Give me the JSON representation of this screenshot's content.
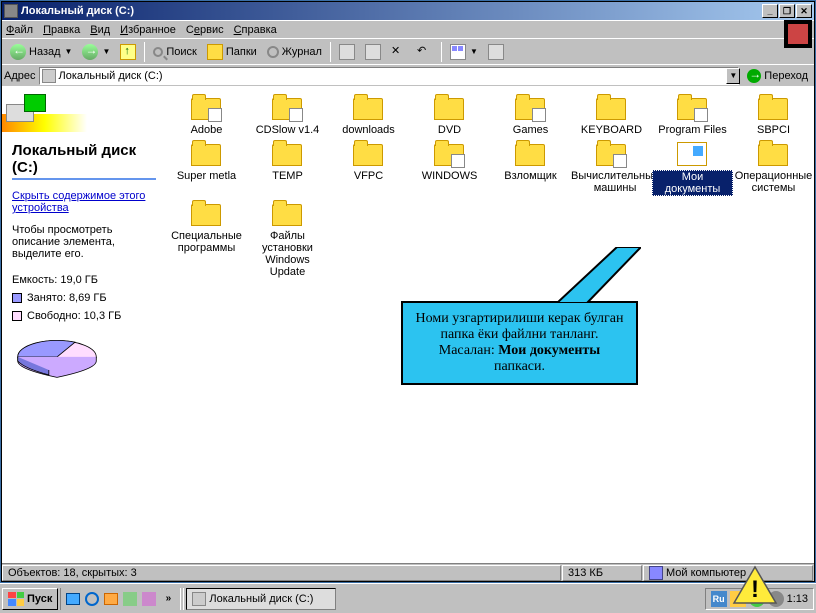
{
  "titlebar": {
    "title": "Локальный диск (C:)"
  },
  "menu": {
    "file": "Файл",
    "edit": "Правка",
    "view": "Вид",
    "fav": "Избранное",
    "tools": "Сервис",
    "help": "Справка"
  },
  "toolbar": {
    "back": "Назад",
    "search": "Поиск",
    "folders": "Папки",
    "history": "Журнал"
  },
  "addrbar": {
    "label": "Адрес",
    "value": "Локальный диск (C:)",
    "go": "Переход"
  },
  "side": {
    "title": "Локальный диск (C:)",
    "link": "Скрыть содержимое этого устройства",
    "desc": "Чтобы просмотреть описание элемента, выделите его.",
    "capacity": "Емкость: 19,0 ГБ",
    "used": "Занято: 8,69 ГБ",
    "free": "Свободно: 10,3 ГБ"
  },
  "items": [
    {
      "label": "Adobe",
      "t": "f",
      "sp": 1
    },
    {
      "label": "CDSlow v1.4",
      "t": "f",
      "sp": 2
    },
    {
      "label": "downloads",
      "t": "f"
    },
    {
      "label": "DVD",
      "t": "f"
    },
    {
      "label": "Games",
      "t": "f",
      "sp": 3
    },
    {
      "label": "KEYBOARD",
      "t": "f"
    },
    {
      "label": "Program Files",
      "t": "f",
      "sp": 4
    },
    {
      "label": "SBPCI",
      "t": "f"
    },
    {
      "label": "Super metla",
      "t": "f"
    },
    {
      "label": "TEMP",
      "t": "f"
    },
    {
      "label": "VFPC",
      "t": "f"
    },
    {
      "label": "WINDOWS",
      "t": "f",
      "sp": 5
    },
    {
      "label": "Взломщик",
      "t": "f"
    },
    {
      "label": "Вычислительные машины",
      "t": "f",
      "sp": 6
    },
    {
      "label": "Мои документы",
      "t": "d",
      "sel": 1
    },
    {
      "label": "Операционные системы",
      "t": "f"
    },
    {
      "label": "Специальные программы",
      "t": "f"
    },
    {
      "label": "Файлы установки Windows Update",
      "t": "f"
    }
  ],
  "callout": {
    "l1": "Номи узгартирилиши керак булган",
    "l2": "папка ёки файлни танланг.",
    "l3a": "Масалан: ",
    "l3b": "Мои документы",
    "l3c": " папкаси."
  },
  "status": {
    "objects": "Объектов: 18, скрытых: 3",
    "size": "313 КБ",
    "loc": "Мой компьютер"
  },
  "taskbar": {
    "start": "Пуск",
    "task": "Локальный диск (C:)",
    "lang": "Ru",
    "clock": "1:13"
  }
}
